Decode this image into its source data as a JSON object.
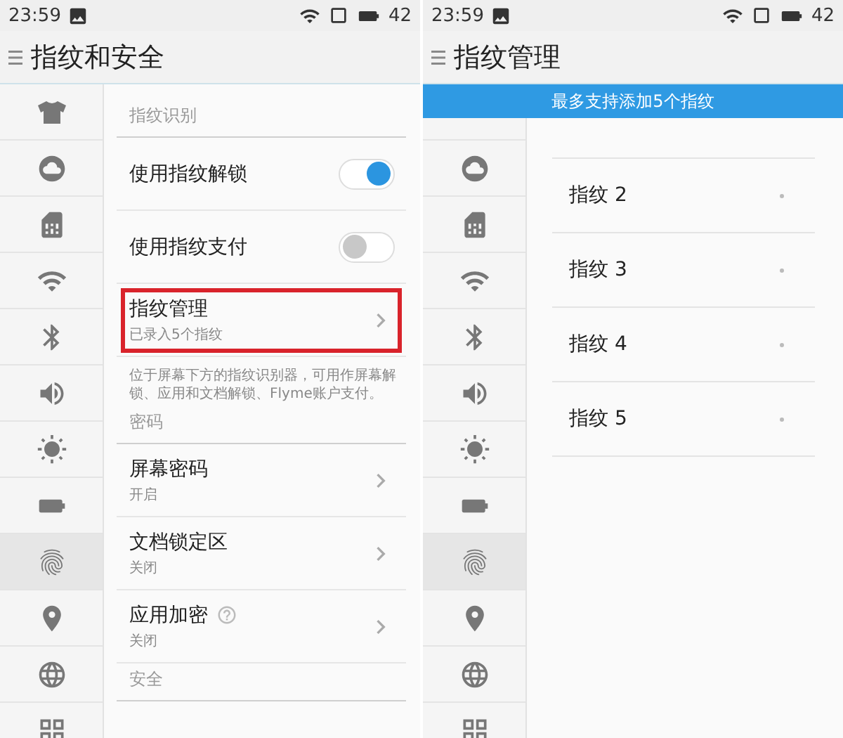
{
  "screens": [
    {
      "status_bar": {
        "time": "23:59",
        "battery": "42"
      },
      "title": "指纹和安全",
      "sidebar": [
        {
          "kind": "shirt",
          "selected": false
        },
        {
          "kind": "cloud",
          "selected": false
        },
        {
          "kind": "sim",
          "selected": false
        },
        {
          "kind": "wifi",
          "selected": false
        },
        {
          "kind": "bluetooth",
          "selected": false
        },
        {
          "kind": "sound",
          "selected": false
        },
        {
          "kind": "brightness",
          "selected": false
        },
        {
          "kind": "battery",
          "selected": false
        },
        {
          "kind": "fingerprint",
          "selected": true
        },
        {
          "kind": "location",
          "selected": false
        },
        {
          "kind": "globe",
          "selected": false
        },
        {
          "kind": "apps",
          "selected": false
        }
      ],
      "items": [
        {
          "kind": "header",
          "label": "指纹识别"
        },
        {
          "kind": "toggle",
          "label": "使用指纹解锁",
          "on": true
        },
        {
          "kind": "toggle",
          "label": "使用指纹支付",
          "on": false
        },
        {
          "kind": "link",
          "label": "指纹管理",
          "value": "已录入5个指纹",
          "highlighted": true
        },
        {
          "kind": "note",
          "text": "位于屏幕下方的指纹识别器，可用作屏幕解锁、应用和文档解锁、Flyme账户支付。"
        },
        {
          "kind": "header",
          "label": "密码"
        },
        {
          "kind": "link",
          "label": "屏幕密码",
          "value": "开启",
          "highlighted": false
        },
        {
          "kind": "link",
          "label": "文档锁定区",
          "value": "关闭",
          "highlighted": false
        },
        {
          "kind": "link",
          "label": "应用加密",
          "value": "关闭",
          "highlighted": false,
          "help": true
        },
        {
          "kind": "header",
          "label": "安全"
        }
      ]
    },
    {
      "status_bar": {
        "time": "23:59",
        "battery": "42"
      },
      "title": "指纹管理",
      "banner": "最多支持添加5个指纹",
      "sidebar": [
        {
          "kind": "cloud",
          "selected": false
        },
        {
          "kind": "sim",
          "selected": false
        },
        {
          "kind": "wifi",
          "selected": false
        },
        {
          "kind": "bluetooth",
          "selected": false
        },
        {
          "kind": "sound",
          "selected": false
        },
        {
          "kind": "brightness",
          "selected": false
        },
        {
          "kind": "battery",
          "selected": false
        },
        {
          "kind": "fingerprint",
          "selected": true
        },
        {
          "kind": "location",
          "selected": false
        },
        {
          "kind": "globe",
          "selected": false
        },
        {
          "kind": "apps",
          "selected": false
        }
      ],
      "items": [
        {
          "kind": "entry",
          "label": "指纹 2"
        },
        {
          "kind": "entry",
          "label": "指纹 3"
        },
        {
          "kind": "entry",
          "label": "指纹 4"
        },
        {
          "kind": "entry",
          "label": "指纹 5"
        }
      ]
    }
  ]
}
